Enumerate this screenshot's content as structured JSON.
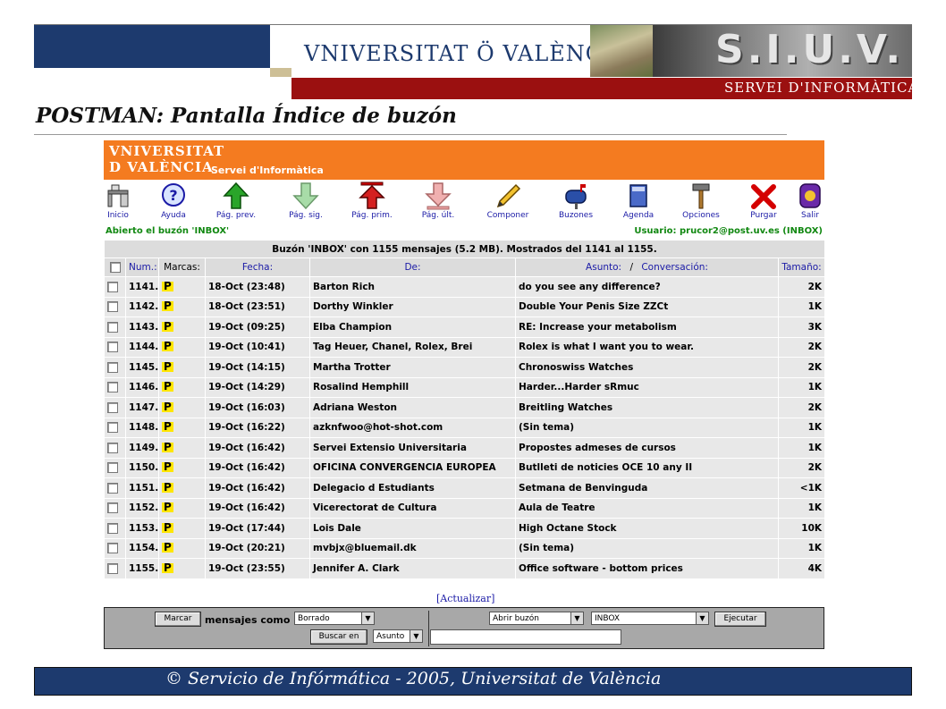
{
  "slide": {
    "header_logo": "VNIVERSITAT Ö VALÈNCIA",
    "header_siuv": "S.I.U.V.",
    "header_servei": "SERVEI D'INFORMÀTICA",
    "title": "POSTMAN: Pantalla Índice de buzón",
    "footer": "© Servicio de Infórmática - 2005, Universitat de València"
  },
  "app": {
    "logo_line1": "VNIVERSITAT",
    "logo_line2": "D VALÈNCIA",
    "servei": "Servei d'Informàtica",
    "toolbar": [
      {
        "label": "Inicio",
        "icon": "desk-icon"
      },
      {
        "label": "Ayuda",
        "icon": "help-icon"
      },
      {
        "label": "Pág. prev.",
        "icon": "arrow-up-icon"
      },
      {
        "label": "Pág. sig.",
        "icon": "arrow-down-icon"
      },
      {
        "label": "Pág. prim.",
        "icon": "arrow-first-icon"
      },
      {
        "label": "Pág. últ.",
        "icon": "arrow-last-icon"
      },
      {
        "label": "Componer",
        "icon": "pencil-icon"
      },
      {
        "label": "Buzones",
        "icon": "mailbox-icon"
      },
      {
        "label": "Agenda",
        "icon": "book-icon"
      },
      {
        "label": "Opciones",
        "icon": "hammer-icon"
      },
      {
        "label": "Purgar",
        "icon": "x-icon"
      },
      {
        "label": "Salir",
        "icon": "exit-icon"
      }
    ],
    "status_left": "Abierto el buzón 'INBOX'",
    "status_right": "Usuario: prucor2@post.uv.es (INBOX)",
    "caption": "Buzón 'INBOX' con 1155 mensajes (5.2 MB). Mostrados del 1141 al 1155.",
    "columns": {
      "num": "Num.:",
      "marcas": "Marcas:",
      "fecha": "Fecha:",
      "de": "De:",
      "asunto": "Asunto:",
      "sep": "/",
      "conversacion": "Conversación:",
      "tamano": "Tamaño:"
    },
    "flag": "P",
    "messages": [
      {
        "num": "1141.",
        "date": "18-Oct  (23:48)",
        "from": "Barton Rich",
        "subject": "do you see any difference?",
        "size": "2K"
      },
      {
        "num": "1142.",
        "date": "18-Oct  (23:51)",
        "from": "Dorthy Winkler",
        "subject": "Double Your Penis Size ZZCt",
        "size": "1K"
      },
      {
        "num": "1143.",
        "date": "19-Oct  (09:25)",
        "from": "Elba Champion",
        "subject": "RE: Increase your metabolism",
        "size": "3K"
      },
      {
        "num": "1144.",
        "date": "19-Oct  (10:41)",
        "from": "Tag Heuer, Chanel, Rolex, Brei",
        "subject": "Rolex is what I want you to wear.",
        "size": "2K"
      },
      {
        "num": "1145.",
        "date": "19-Oct  (14:15)",
        "from": "Martha Trotter",
        "subject": "Chronoswiss Watches",
        "size": "2K"
      },
      {
        "num": "1146.",
        "date": "19-Oct  (14:29)",
        "from": "Rosalind Hemphill",
        "subject": "Harder...Harder sRmuc",
        "size": "1K"
      },
      {
        "num": "1147.",
        "date": "19-Oct  (16:03)",
        "from": "Adriana Weston",
        "subject": "Breitling Watches",
        "size": "2K"
      },
      {
        "num": "1148.",
        "date": "19-Oct  (16:22)",
        "from": "azknfwoo@hot-shot.com",
        "subject": "(Sin tema)",
        "size": "1K"
      },
      {
        "num": "1149.",
        "date": "19-Oct  (16:42)",
        "from": "Servei Extensio Universitaria",
        "subject": "Propostes admeses de cursos",
        "size": "1K"
      },
      {
        "num": "1150.",
        "date": "19-Oct  (16:42)",
        "from": "OFICINA CONVERGENCIA EUROPEA",
        "subject": "Butlleti de noticies OCE 10 any II",
        "size": "2K"
      },
      {
        "num": "1151.",
        "date": "19-Oct  (16:42)",
        "from": "Delegacio d Estudiants",
        "subject": "Setmana de Benvinguda",
        "size": "<1K"
      },
      {
        "num": "1152.",
        "date": "19-Oct  (16:42)",
        "from": "Vicerectorat de Cultura",
        "subject": "Aula de Teatre",
        "size": "1K"
      },
      {
        "num": "1153.",
        "date": "19-Oct  (17:44)",
        "from": "Lois Dale",
        "subject": "High Octane Stock",
        "size": "10K"
      },
      {
        "num": "1154.",
        "date": "19-Oct  (20:21)",
        "from": "mvbjx@bluemail.dk",
        "subject": "(Sin tema)",
        "size": "1K"
      },
      {
        "num": "1155.",
        "date": "19-Oct  (23:55)",
        "from": "Jennifer A. Clark",
        "subject": "Office software - bottom prices",
        "size": "4K"
      }
    ],
    "refresh": "[Actualizar]",
    "form": {
      "marcar": "Marcar",
      "label": "mensajes como",
      "mark_select": "Borrado",
      "open_select": "Abrir buzón",
      "mailbox_select": "INBOX",
      "ejecutar": "Ejecutar",
      "buscar": "Buscar en",
      "search_field_select": "Asunto",
      "search_value": ""
    }
  },
  "colors": {
    "orange": "#f47b20",
    "navy": "#1d3a6e",
    "red": "#9b1010",
    "link_blue": "#1a1aa6",
    "status_green": "#118811"
  }
}
